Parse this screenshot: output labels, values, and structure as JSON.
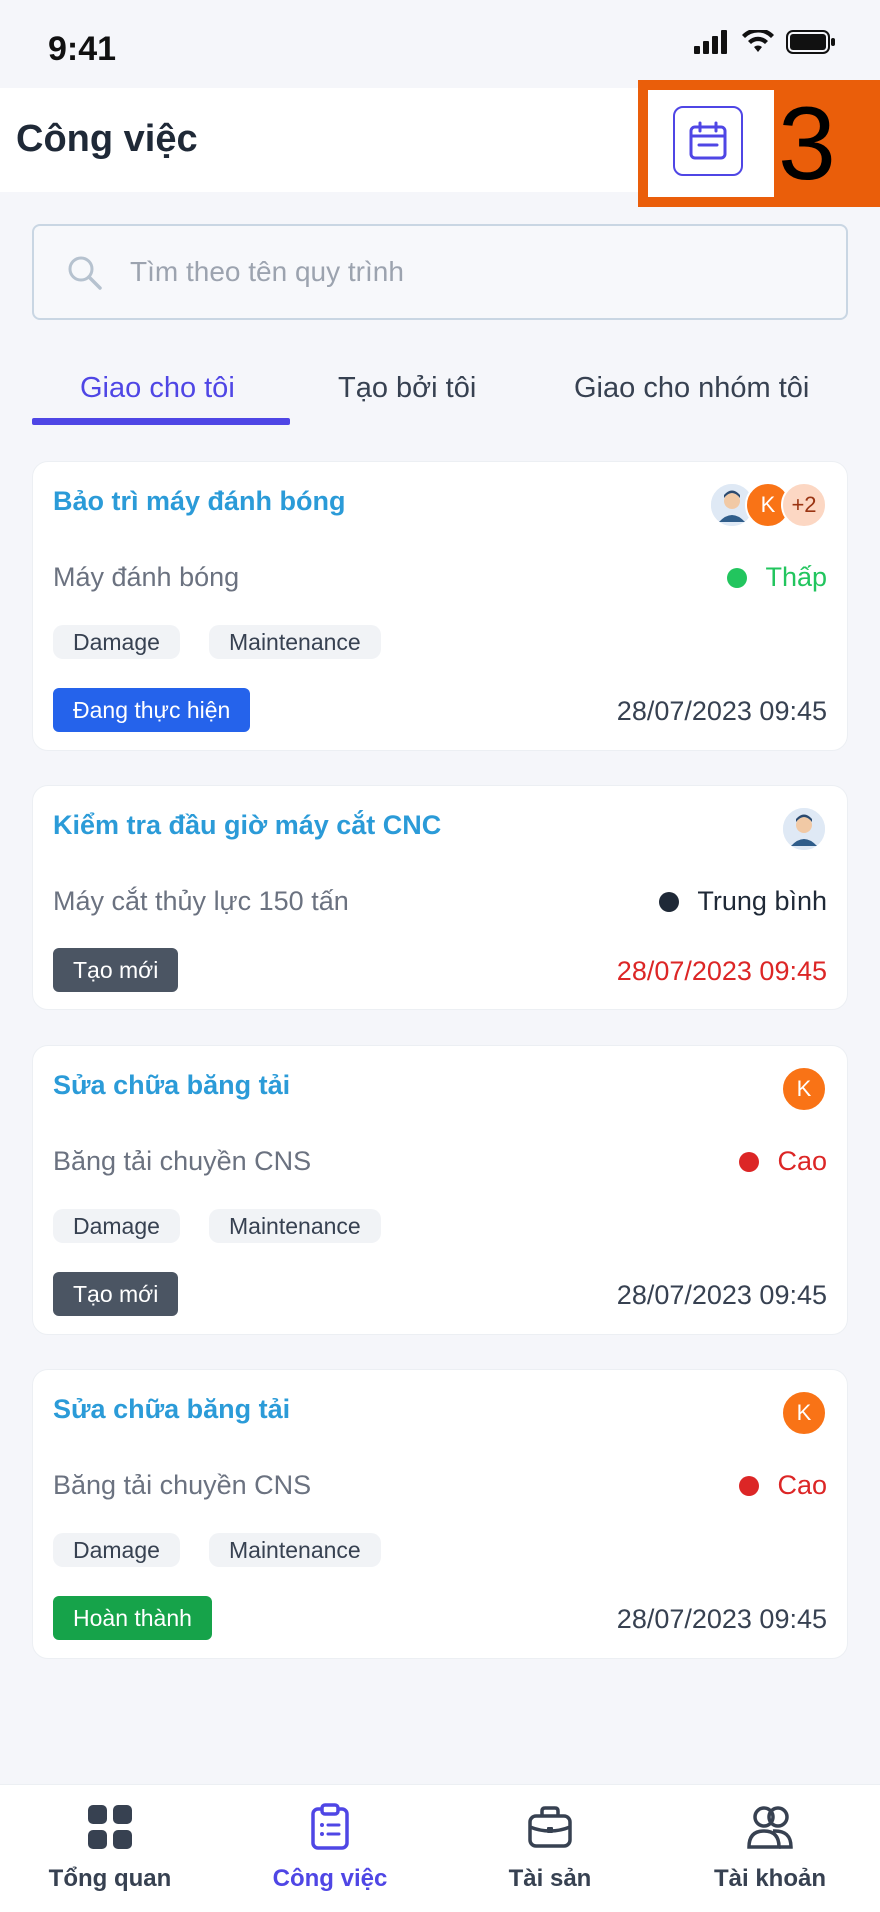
{
  "status_bar": {
    "time": "9:41"
  },
  "header": {
    "title": "Công việc",
    "annotation_number": "3"
  },
  "search": {
    "placeholder": "Tìm theo tên quy trình"
  },
  "tabs": [
    {
      "label": "Giao cho tôi",
      "active": true
    },
    {
      "label": "Tạo bởi tôi",
      "active": false
    },
    {
      "label": "Giao cho nhóm tôi",
      "active": false
    }
  ],
  "cards": [
    {
      "title": "Bảo trì máy đánh bóng",
      "asset": "Máy đánh bóng",
      "priority": "Thấp",
      "priority_color": "#22c55e",
      "tags": [
        "Damage",
        "Maintenance"
      ],
      "status": "Đang thực hiện",
      "status_color": "#2563eb",
      "date": "28/07/2023 09:45",
      "date_color": "#374151",
      "avatars": [
        "photo",
        "K",
        "+2"
      ]
    },
    {
      "title": "Kiểm tra đầu giờ máy cắt CNC",
      "asset": "Máy cắt thủy lực 150 tấn",
      "priority": "Trung bình",
      "priority_color": "#1f2937",
      "tags": [],
      "status": "Tạo mới",
      "status_color": "#4b5563",
      "date": "28/07/2023 09:45",
      "date_color": "#dc2626",
      "avatars": [
        "photo"
      ]
    },
    {
      "title": "Sửa chữa băng tải",
      "asset": "Băng tải chuyền CNS",
      "priority": "Cao",
      "priority_color": "#dc2626",
      "tags": [
        "Damage",
        "Maintenance"
      ],
      "status": "Tạo mới",
      "status_color": "#4b5563",
      "date": "28/07/2023 09:45",
      "date_color": "#374151",
      "avatars": [
        "K"
      ]
    },
    {
      "title": "Sửa chữa băng tải",
      "asset": "Băng tải chuyền CNS",
      "priority": "Cao",
      "priority_color": "#dc2626",
      "tags": [
        "Damage",
        "Maintenance"
      ],
      "status": "Hoàn thành",
      "status_color": "#16a34a",
      "date": "28/07/2023 09:45",
      "date_color": "#374151",
      "avatars": [
        "K"
      ]
    }
  ],
  "bottom_nav": [
    {
      "label": "Tổng quan",
      "icon": "grid-icon",
      "active": false
    },
    {
      "label": "Công việc",
      "icon": "clipboard-icon",
      "active": true
    },
    {
      "label": "Tài sản",
      "icon": "briefcase-icon",
      "active": false
    },
    {
      "label": "Tài khoản",
      "icon": "users-icon",
      "active": false
    }
  ],
  "colors": {
    "accent": "#4f46e5",
    "title_blue": "#2b9bd8",
    "annotation": "#ea5e0a"
  }
}
